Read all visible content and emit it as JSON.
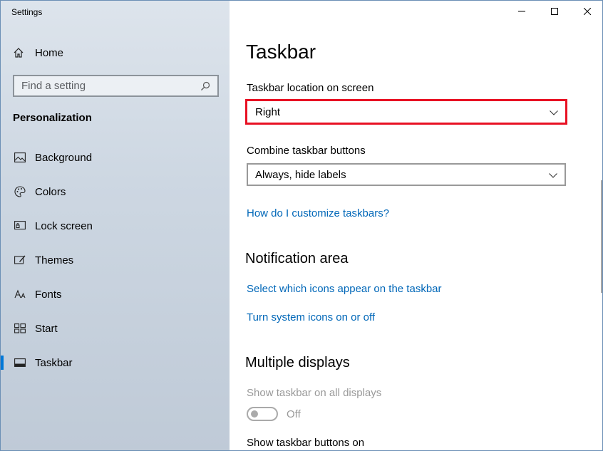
{
  "window": {
    "title": "Settings"
  },
  "sidebar": {
    "home_label": "Home",
    "search_placeholder": "Find a setting",
    "section_title": "Personalization",
    "items": [
      {
        "label": "Background",
        "icon": "background-icon",
        "active": false
      },
      {
        "label": "Colors",
        "icon": "palette-icon",
        "active": false
      },
      {
        "label": "Lock screen",
        "icon": "lock-screen-icon",
        "active": false
      },
      {
        "label": "Themes",
        "icon": "themes-icon",
        "active": false
      },
      {
        "label": "Fonts",
        "icon": "fonts-icon",
        "active": false
      },
      {
        "label": "Start",
        "icon": "start-icon",
        "active": false
      },
      {
        "label": "Taskbar",
        "icon": "taskbar-icon",
        "active": true
      }
    ]
  },
  "main": {
    "title": "Taskbar",
    "location_label": "Taskbar location on screen",
    "location_value": "Right",
    "combine_label": "Combine taskbar buttons",
    "combine_value": "Always, hide labels",
    "customize_link": "How do I customize taskbars?",
    "notification_heading": "Notification area",
    "notif_link1": "Select which icons appear on the taskbar",
    "notif_link2": "Turn system icons on or off",
    "multiple_heading": "Multiple displays",
    "show_all_label": "Show taskbar on all displays",
    "toggle_state": "Off",
    "show_buttons_label": "Show taskbar buttons on"
  },
  "colors": {
    "accent": "#0078d7",
    "link": "#0067b8",
    "highlight": "#e81123"
  }
}
